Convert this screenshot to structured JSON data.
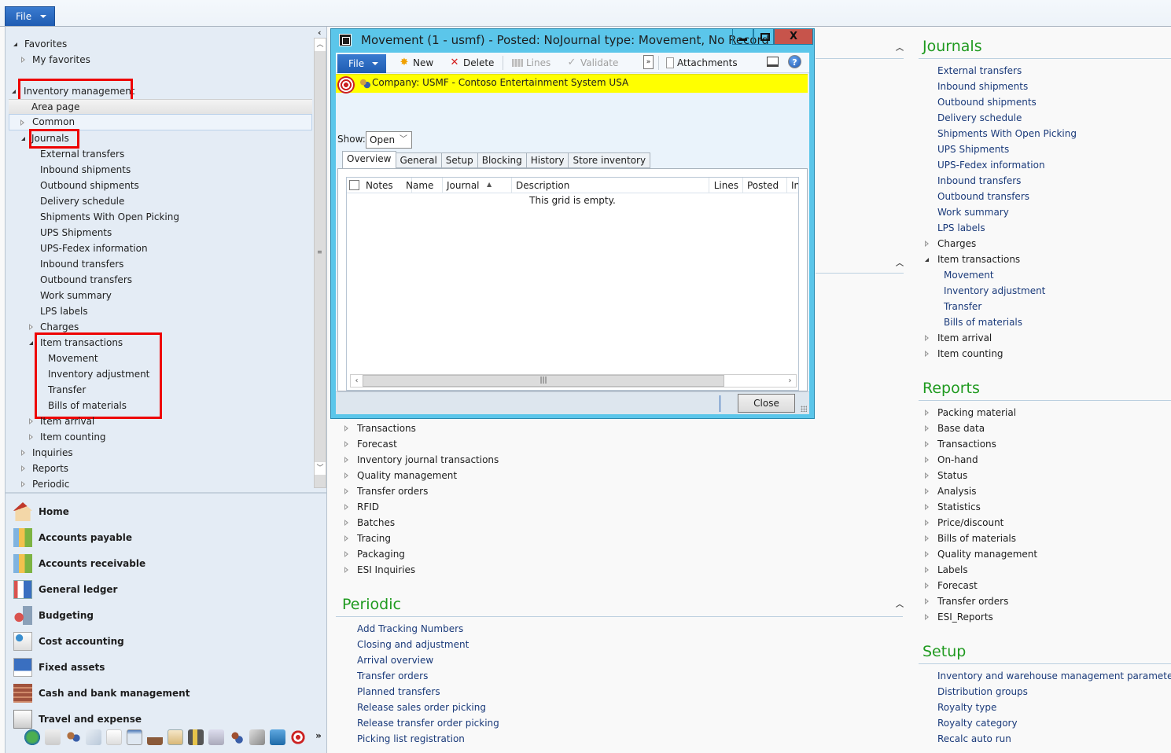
{
  "topbar": {
    "file_label": "File"
  },
  "nav": {
    "favorites": "Favorites",
    "my_favorites": "My favorites",
    "module": "Inventory management",
    "area_page": "Area page",
    "common": "Common",
    "journals": "Journals",
    "journal_items": [
      "External transfers",
      "Inbound shipments",
      "Outbound shipments",
      "Delivery schedule",
      "Shipments With Open Picking",
      "UPS Shipments",
      "UPS-Fedex information",
      "Inbound transfers",
      "Outbound transfers",
      "Work summary",
      "LPS labels"
    ],
    "charges": "Charges",
    "item_transactions": "Item transactions",
    "item_transaction_items": [
      "Movement",
      "Inventory adjustment",
      "Transfer",
      "Bills of materials"
    ],
    "item_arrival": "Item arrival",
    "item_counting": "Item counting",
    "inquiries": "Inquiries",
    "reports": "Reports",
    "periodic": "Periodic"
  },
  "modules": [
    {
      "label": "Home",
      "icon": "home-icon"
    },
    {
      "label": "Accounts payable",
      "icon": "accounts-payable-icon"
    },
    {
      "label": "Accounts receivable",
      "icon": "accounts-receivable-icon"
    },
    {
      "label": "General ledger",
      "icon": "general-ledger-icon"
    },
    {
      "label": "Budgeting",
      "icon": "budgeting-icon"
    },
    {
      "label": "Cost accounting",
      "icon": "cost-accounting-icon"
    },
    {
      "label": "Fixed assets",
      "icon": "fixed-assets-icon"
    },
    {
      "label": "Cash and bank management",
      "icon": "cash-bank-icon"
    },
    {
      "label": "Travel and expense",
      "icon": "travel-expense-icon"
    }
  ],
  "module_bar_more": "»",
  "dialog": {
    "title": "Movement (1 - usmf) - Posted: NoJournal type: Movement, No Record",
    "close_glyph": "X",
    "toolbar": {
      "file": "File",
      "new": "New",
      "delete": "Delete",
      "lines": "Lines",
      "validate": "Validate",
      "overflow": "»",
      "attachments": "Attachments"
    },
    "company": "Company: USMF - Contoso Entertainment System USA",
    "show_label": "Show:",
    "show_value": "Open",
    "tabs": [
      "Overview",
      "General",
      "Setup",
      "Blocking",
      "History",
      "Store inventory"
    ],
    "grid_columns": [
      "Notes",
      "Name",
      "Journal",
      "Description",
      "Lines",
      "Posted",
      "In"
    ],
    "grid_empty": "This grid is empty.",
    "close_button": "Close"
  },
  "main": {
    "inquiries_groups": [
      "Transactions",
      "Forecast",
      "Inventory journal transactions",
      "Quality management",
      "Transfer orders",
      "RFID",
      "Batches",
      "Tracing",
      "Packaging",
      "ESI Inquiries"
    ],
    "periodic": {
      "title": "Periodic",
      "items": [
        "Add Tracking Numbers",
        "Closing and adjustment",
        "Arrival overview",
        "Transfer orders",
        "Planned transfers",
        "Release sales order picking",
        "Release transfer order picking",
        "Picking list registration"
      ]
    },
    "journals": {
      "title": "Journals",
      "items": [
        "External transfers",
        "Inbound shipments",
        "Outbound shipments",
        "Delivery schedule",
        "Shipments With Open Picking",
        "UPS Shipments",
        "UPS-Fedex information",
        "Inbound transfers",
        "Outbound transfers",
        "Work summary",
        "LPS labels"
      ],
      "charges": "Charges",
      "item_transactions": "Item transactions",
      "item_transaction_items": [
        "Movement",
        "Inventory adjustment",
        "Transfer",
        "Bills of materials"
      ],
      "item_arrival": "Item arrival",
      "item_counting": "Item counting"
    },
    "reports": {
      "title": "Reports",
      "items": [
        "Packing material",
        "Base data",
        "Transactions",
        "On-hand",
        "Status",
        "Analysis",
        "Statistics",
        "Price/discount",
        "Bills of materials",
        "Quality management",
        "Labels",
        "Forecast",
        "Transfer orders",
        "ESI_Reports"
      ]
    },
    "setup": {
      "title": "Setup",
      "items": [
        "Inventory and warehouse management parameters",
        "Distribution groups",
        "Royalty type",
        "Royalty category",
        "Recalc auto run"
      ]
    }
  }
}
